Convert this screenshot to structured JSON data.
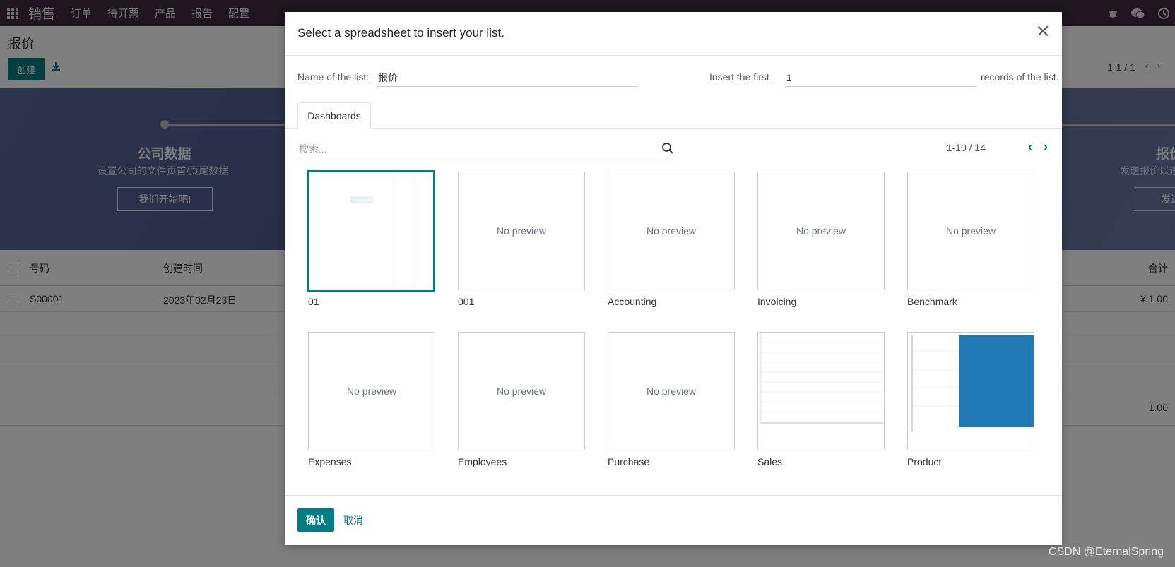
{
  "navbar": {
    "brand": "销售",
    "menu": [
      "订单",
      "待开票",
      "产品",
      "报告",
      "配置"
    ],
    "icons": [
      "bug-icon",
      "chat-icon",
      "clock-icon"
    ]
  },
  "control_panel": {
    "breadcrumb": "报价",
    "create_label": "创建",
    "pager": "1-1 / 1"
  },
  "banner": {
    "title": "公司数据",
    "subtitle": "设置公司的文件页首/页尾数据.",
    "button": "我们开始吧!",
    "title_right": "报价",
    "subtitle_right": "发送报价以进",
    "button_right": "发送"
  },
  "list": {
    "headers": {
      "number": "号码",
      "created": "创建时间",
      "total": "合计"
    },
    "rows": [
      {
        "number": "S00001",
        "created": "2023年02月23日",
        "total": "¥ 1.00"
      }
    ],
    "footer_total": "1.00"
  },
  "modal": {
    "title": "Select a spreadsheet to insert your list.",
    "name_label": "Name of the list:",
    "name_value": "报价",
    "insert_label": "Insert the first",
    "insert_value": "1",
    "records_label": "records of the list.",
    "tab": "Dashboards",
    "search_placeholder": "搜索...",
    "pager": "1-10 / 14",
    "no_preview": "No preview",
    "items": [
      {
        "label": "01",
        "preview": "thumb",
        "selected": true
      },
      {
        "label": "001",
        "preview": "none"
      },
      {
        "label": "Accounting",
        "preview": "none"
      },
      {
        "label": "Invoicing",
        "preview": "none"
      },
      {
        "label": "Benchmark",
        "preview": "none"
      },
      {
        "label": "Expenses",
        "preview": "none"
      },
      {
        "label": "Employees",
        "preview": "none"
      },
      {
        "label": "Purchase",
        "preview": "none"
      },
      {
        "label": "Sales",
        "preview": "thumb"
      },
      {
        "label": "Product",
        "preview": "thumb"
      }
    ],
    "confirm_label": "确认",
    "cancel_label": "取消"
  },
  "watermark": "CSDN @EternalSpring",
  "colors": {
    "primary": "#017e84",
    "navbar": "#3d2a3c"
  }
}
